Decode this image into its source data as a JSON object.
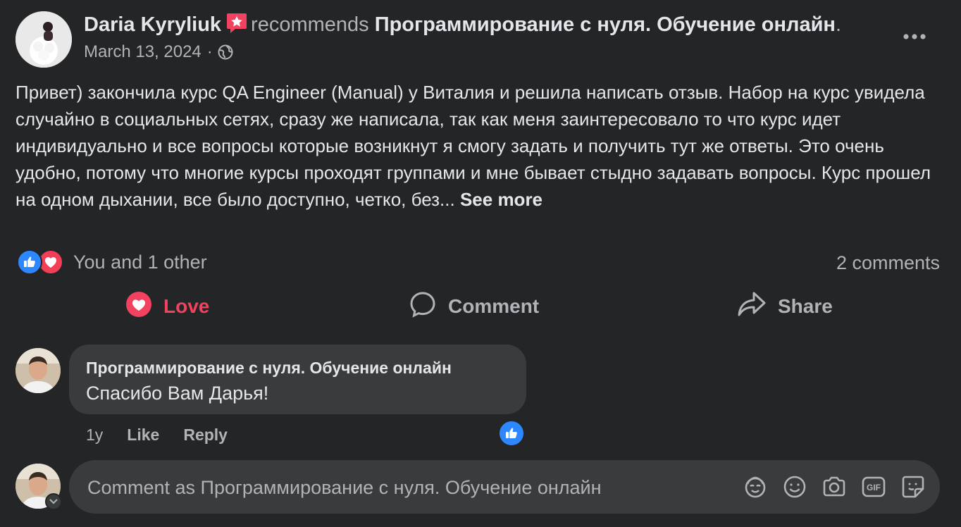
{
  "post": {
    "author": "Daria Kyryliuk",
    "action_word": "recommends",
    "page_name": "Программирование с нуля. Обучение онлайн",
    "page_name_suffix": ".",
    "date": "March 13, 2024",
    "separator": "·",
    "privacy_icon": "globe-icon",
    "text": "Привет) закончила курс QA Engineer (Manual) у Виталия и решила написать отзыв. Набор на курс увидела случайно в социальных сетях, сразу же написала, так как меня заинтересовало то что курс идет индивидуально и все вопросы которые возникнут я смогу задать и получить тут же ответы. Это очень удобно, потому что многие курсы проходят группами и мне бывает стыдно задавать вопросы. Курс прошел на одном дыхании, все было доступно, четко, без...",
    "see_more": "See more"
  },
  "reactions": {
    "icons": [
      "like-icon",
      "love-icon"
    ],
    "summary": "You and 1 other",
    "comments_count": "2 comments"
  },
  "actions": {
    "love": "Love",
    "comment": "Comment",
    "share": "Share"
  },
  "comment": {
    "author": "Программирование с нуля. Обучение онлайн",
    "text": "Спасибо Вам Дарья!",
    "age": "1y",
    "like": "Like",
    "reply": "Reply"
  },
  "composer": {
    "placeholder": "Comment as Программирование с нуля. Обучение онлайн",
    "tools": [
      "avatar-sticker-icon",
      "emoji-icon",
      "camera-icon",
      "gif-icon",
      "sticker-icon"
    ]
  },
  "colors": {
    "background": "#242526",
    "bubble": "#3a3b3c",
    "text_primary": "#e4e6eb",
    "text_secondary": "#b0b3b8",
    "love": "#f3425f",
    "like": "#2d88ff"
  }
}
